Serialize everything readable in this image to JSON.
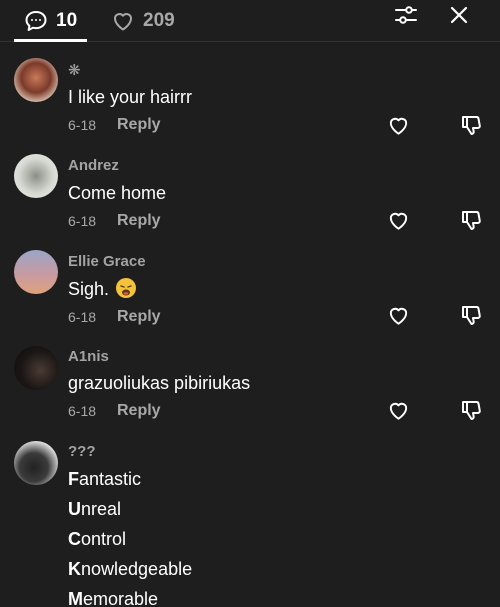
{
  "tabs": {
    "comments_count": "10",
    "likes_count": "209"
  },
  "icons": {
    "comments_tab": "comment-bubble-icon",
    "likes_tab": "heart-outline-icon",
    "filter": "sliders-icon",
    "close": "close-x-icon",
    "like": "heart-outline-icon",
    "dislike": "thumbs-down-outline-icon"
  },
  "colors": {
    "background": "#1e1e1e",
    "text": "#ffffff",
    "muted": "#a8a8a8"
  },
  "reply_label": "Reply",
  "comments": [
    {
      "username": "❋",
      "text": "I like your hairrr",
      "date": "6-18"
    },
    {
      "username": "Andrez",
      "text": "Come home",
      "date": "6-18"
    },
    {
      "username": "Ellie Grace",
      "text": "Sigh.",
      "date": "6-18"
    },
    {
      "username": "A1nis",
      "text": "grazuoliukas pibiriukas",
      "date": "6-18"
    },
    {
      "username": "???",
      "lines": [
        {
          "initial": "F",
          "rest": "antastic"
        },
        {
          "initial": "U",
          "rest": "nreal"
        },
        {
          "initial": "C",
          "rest": "ontrol"
        },
        {
          "initial": "K",
          "rest": "nowledgeable"
        },
        {
          "initial": "M",
          "rest": "emorable"
        }
      ]
    }
  ]
}
